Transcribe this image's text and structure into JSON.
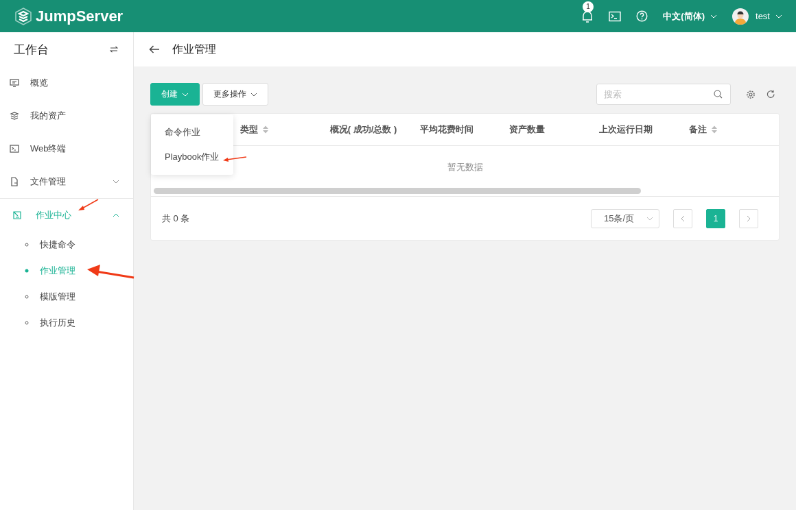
{
  "topbar": {
    "logo": "JumpServer",
    "notification_count": "1",
    "language": "中文(简体)",
    "user": "test"
  },
  "sidebar": {
    "title": "工作台",
    "items": [
      {
        "label": "概览",
        "kind": "link",
        "selected": false
      },
      {
        "label": "我的资产",
        "kind": "link",
        "selected": false
      },
      {
        "label": "Web终端",
        "kind": "link",
        "selected": false
      },
      {
        "label": "文件管理",
        "kind": "group",
        "selected": false,
        "expanded": false
      },
      {
        "label": "作业中心",
        "kind": "group",
        "selected": true,
        "expanded": true,
        "children": [
          {
            "label": "快捷命令",
            "selected": false
          },
          {
            "label": "作业管理",
            "selected": true
          },
          {
            "label": "模版管理",
            "selected": false
          },
          {
            "label": "执行历史",
            "selected": false
          }
        ]
      }
    ]
  },
  "page": {
    "title": "作业管理"
  },
  "toolbar": {
    "create_button": "创建",
    "more_button": "更多操作",
    "search": {
      "placeholder": "搜索"
    }
  },
  "dropdown": {
    "items": [
      "命令作业",
      "Playbook作业"
    ]
  },
  "table": {
    "columns": [
      {
        "label": "类型",
        "sortable": true
      },
      {
        "label": "概况( 成功/总数 )",
        "sortable": false
      },
      {
        "label": "平均花费时间",
        "sortable": false
      },
      {
        "label": "资产数量",
        "sortable": false
      },
      {
        "label": "上次运行日期",
        "sortable": false
      },
      {
        "label": "备注",
        "sortable": true
      }
    ],
    "empty_text": "暂无数据"
  },
  "pagination": {
    "total": "共 0 条",
    "page_size": "15条/页",
    "pages": [
      {
        "label": "1",
        "selected": true
      }
    ]
  }
}
